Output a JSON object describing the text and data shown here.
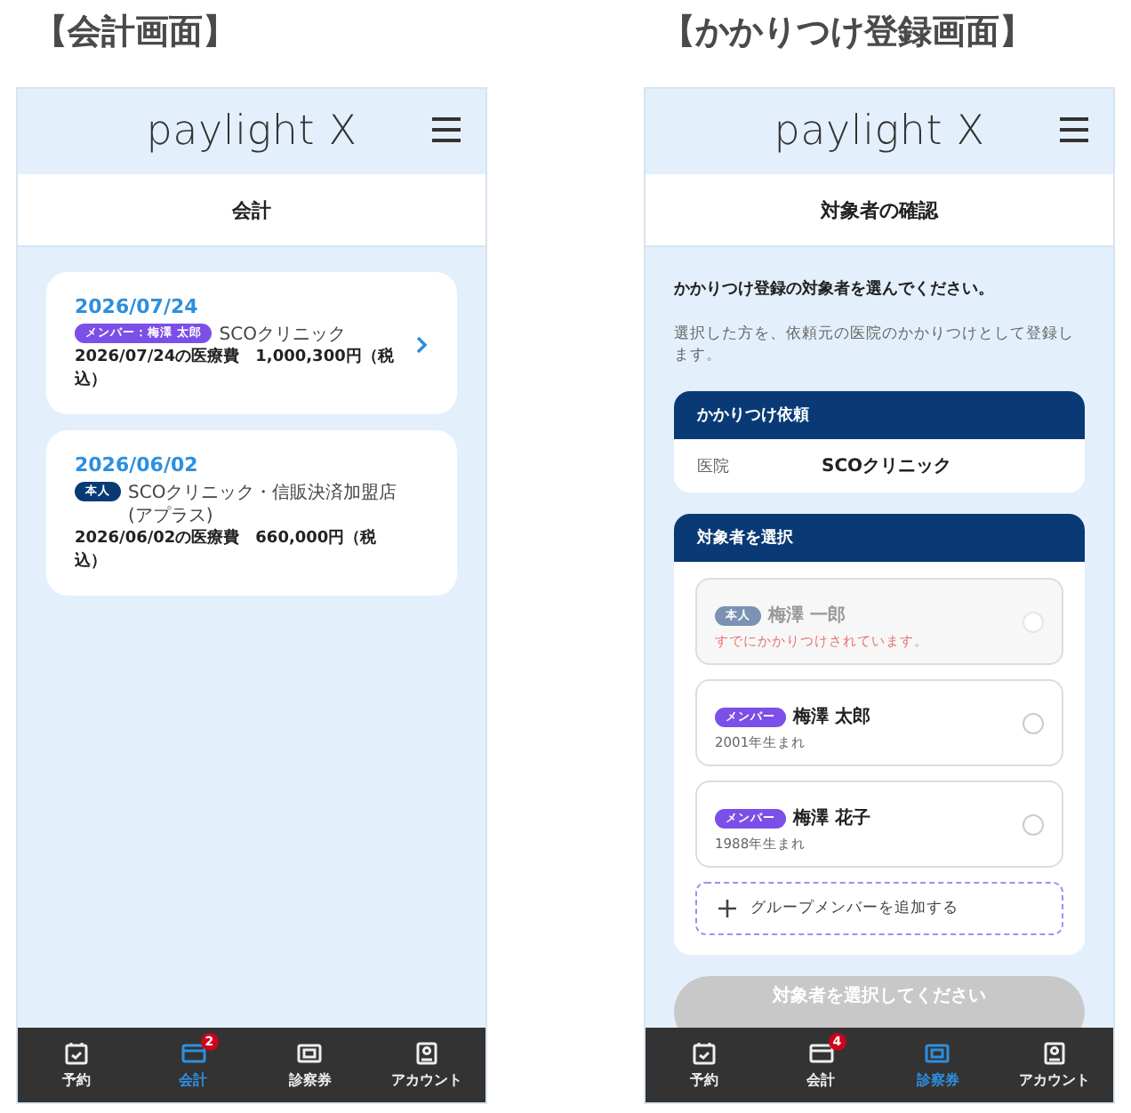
{
  "screens": [
    {
      "caption": "【会計画面】",
      "logo": "paylight X",
      "page_title": "会計",
      "kind": "billing",
      "bills": [
        {
          "date": "2026/07/24",
          "tag": "メンバー：梅澤 太郎",
          "color": "#7b4fe8",
          "clinic": "SCOクリニック",
          "amount": "2026/07/24の医療費　1,000,300円（税込）",
          "chevron": true
        },
        {
          "date": "2026/06/02",
          "tag": "本人",
          "color": "#0a3a75",
          "clinic": "SCOクリニック・信販決済加盟店(アプラス)",
          "amount": "2026/06/02の医療費　660,000円（税込）",
          "chevron": false
        }
      ],
      "nav": [
        {
          "label": "予約",
          "selected": false
        },
        {
          "label": "会計",
          "selected": true,
          "badge": "2"
        },
        {
          "label": "診察券",
          "selected": false
        },
        {
          "label": "アカウント",
          "selected": false
        }
      ]
    },
    {
      "caption": "【かかりつけ登録画面】",
      "logo": "paylight X",
      "page_title": "対象者の確認",
      "kind": "registration",
      "lead": "かかりつけ登録の対象者を選んでください。",
      "description": "選択した方を、依頼元の医院のかかりつけとして登録します。",
      "request": {
        "title": "かかりつけ依頼",
        "label": "医院",
        "value": "SCOクリニック"
      },
      "selection": {
        "title": "対象者を選択",
        "options": [
          {
            "tag": "本人",
            "color": "#7b92b2",
            "name": "梅澤 一郎",
            "note": "すでにかかりつけされています。",
            "disabled": true,
            "selected": false
          },
          {
            "tag": "メンバー",
            "color": "#7b4fe8",
            "name": "梅澤 太郎",
            "note": "2001年生まれ",
            "disabled": false,
            "selected": false
          },
          {
            "tag": "メンバー",
            "color": "#7b4fe8",
            "name": "梅澤 花子",
            "note": "1988年生まれ",
            "disabled": false,
            "selected": false
          }
        ],
        "add": "グループメンバーを追加する"
      },
      "submit": {
        "label": "対象者を選択してください",
        "disabled": true
      },
      "nav": [
        {
          "label": "予約",
          "selected": false
        },
        {
          "label": "会計",
          "selected": false,
          "badge": "4"
        },
        {
          "label": "診察券",
          "selected": true
        },
        {
          "label": "アカウント",
          "selected": false
        }
      ]
    }
  ]
}
